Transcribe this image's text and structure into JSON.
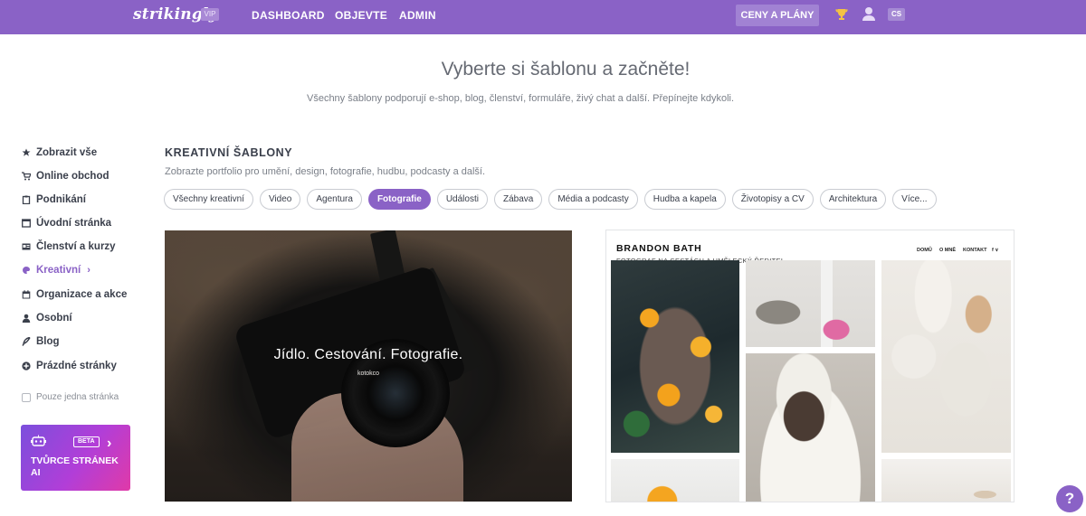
{
  "topbar": {
    "logo": "strikingly",
    "vip_badge": "VIP",
    "nav": [
      "DASHBOARD",
      "OBJEVTE",
      "ADMIN"
    ],
    "pricing_button": "CENY A PLÁNY",
    "language": "CS",
    "icons": [
      "trophy-icon",
      "user-icon"
    ]
  },
  "hero": {
    "title": "Vyberte si šablonu a začněte!",
    "subtitle": "Všechny šablony podporují e-shop, blog, členství, formuláře, živý chat a další. Přepínejte kdykoli."
  },
  "sidebar": {
    "items": [
      {
        "label": "Zobrazit vše",
        "icon": "star-icon"
      },
      {
        "label": "Online obchod",
        "icon": "cart-icon"
      },
      {
        "label": "Podnikání",
        "icon": "clipboard-icon"
      },
      {
        "label": "Úvodní stránka",
        "icon": "window-icon"
      },
      {
        "label": "Členství a kurzy",
        "icon": "id-card-icon"
      },
      {
        "label": "Kreativní",
        "icon": "palette-icon",
        "active": true
      },
      {
        "label": "Organizace a akce",
        "icon": "calendar-icon"
      },
      {
        "label": "Osobní",
        "icon": "person-icon"
      },
      {
        "label": "Blog",
        "icon": "quill-icon"
      },
      {
        "label": "Prázdné stránky",
        "icon": "plus-circle-icon"
      }
    ],
    "single_page_checkbox": "Pouze jedna stránka",
    "ai_card": {
      "beta": "BETA",
      "title": "TVŮRCE STRÁNEK AI"
    }
  },
  "main": {
    "section_title": "KREATIVNÍ ŠABLONY",
    "section_subtitle": "Zobrazte portfolio pro umění, design, fotografie, hudbu, podcasty a další.",
    "filters": [
      {
        "label": "Všechny kreativní"
      },
      {
        "label": "Video"
      },
      {
        "label": "Agentura"
      },
      {
        "label": "Fotografie",
        "active": true
      },
      {
        "label": "Události"
      },
      {
        "label": "Zábava"
      },
      {
        "label": "Média a podcasty"
      },
      {
        "label": "Hudba a kapela"
      },
      {
        "label": "Životopisy a CV"
      },
      {
        "label": "Architektura"
      },
      {
        "label": "Více..."
      }
    ],
    "templates": [
      {
        "title": "Jídlo. Cestování. Fotografie.",
        "subtitle": "kotokco"
      },
      {
        "name": "BRANDON BATH",
        "role": "FOTOGRAF NA CESTÁCH A UMĚLECKÝ ŘEDITEL",
        "menu": [
          "DOMŮ",
          "O MNĚ",
          "KONTAKT",
          "f ∨"
        ]
      }
    ]
  },
  "help_button": "?",
  "colors": {
    "brand": "#8a62c6",
    "text": "#3a3f4b"
  }
}
